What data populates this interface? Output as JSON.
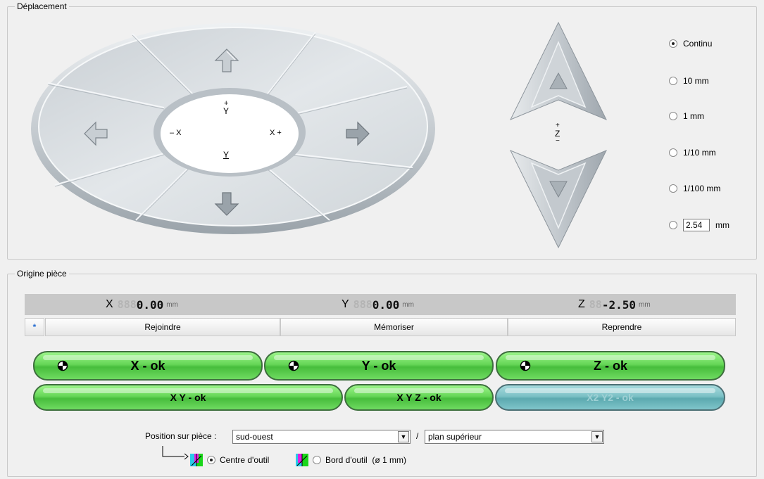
{
  "deplacement": {
    "title": "Déplacement",
    "ellipse_labels": {
      "y_plus_sign": "+",
      "y_plus": "Y",
      "y_minus": "Y",
      "y_minus_sign": "−",
      "x_minus": "– X",
      "x_plus": "X +"
    },
    "z_labels": {
      "plus": "+",
      "z": "Z",
      "minus": "−"
    },
    "step_options": [
      {
        "label": "Continu",
        "selected": true
      },
      {
        "label": "10 mm",
        "selected": false
      },
      {
        "label": "1 mm",
        "selected": false
      },
      {
        "label": "1/10 mm",
        "selected": false
      },
      {
        "label": "1/100 mm",
        "selected": false
      }
    ],
    "custom_step": {
      "value": "2.54",
      "unit": "mm",
      "selected": false
    }
  },
  "origine": {
    "title": "Origine pièce",
    "coords": [
      {
        "axis": "X",
        "ghost": "888",
        "value": "0.00",
        "unit": "mm"
      },
      {
        "axis": "Y",
        "ghost": "888",
        "value": "0.00",
        "unit": "mm"
      },
      {
        "axis": "Z",
        "ghost": "88",
        "value": "-2.50",
        "unit": "mm"
      }
    ],
    "star_label": "*",
    "buttons": {
      "rejoindre": "Rejoindre",
      "memoriser": "Mémoriser",
      "reprendre": "Reprendre"
    },
    "ok_buttons": {
      "x": "X - ok",
      "y": "Y - ok",
      "z": "Z - ok",
      "xy": "X Y - ok",
      "xyz": "X Y Z - ok",
      "x2y2": "X2 Y2 - ok"
    },
    "position_label": "Position sur pièce :",
    "position_value": "sud-ouest",
    "separator": "/",
    "plan_value": "plan supérieur",
    "tool_options": [
      {
        "label": "Centre d'outil",
        "selected": true
      },
      {
        "label": "Bord d'outil  (ø 1 mm)",
        "selected": false
      }
    ]
  },
  "colors": {
    "ok_green": "#5fd451",
    "disabled_teal": "#7cc1c6",
    "dial_grey": "#d6dadd"
  }
}
